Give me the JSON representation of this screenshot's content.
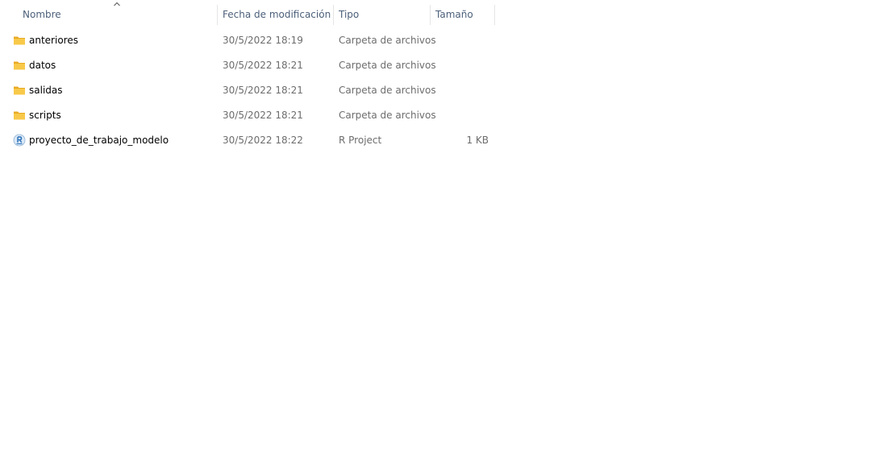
{
  "columns": {
    "name": "Nombre",
    "modified": "Fecha de modificación",
    "type": "Tipo",
    "size": "Tamaño"
  },
  "sort": {
    "column": "name",
    "icon": "chevron-up-icon"
  },
  "colors": {
    "folder": "#f8c94a",
    "folder_back": "#e8aa24",
    "rproject": "#2a6fb8"
  },
  "files": [
    {
      "name": "anteriores",
      "modified": "30/5/2022 18:19",
      "type": "Carpeta de archivos",
      "size": "",
      "icon": "folder-icon"
    },
    {
      "name": "datos",
      "modified": "30/5/2022 18:21",
      "type": "Carpeta de archivos",
      "size": "",
      "icon": "folder-icon"
    },
    {
      "name": "salidas",
      "modified": "30/5/2022 18:21",
      "type": "Carpeta de archivos",
      "size": "",
      "icon": "folder-icon"
    },
    {
      "name": "scripts",
      "modified": "30/5/2022 18:21",
      "type": "Carpeta de archivos",
      "size": "",
      "icon": "folder-icon"
    },
    {
      "name": "proyecto_de_trabajo_modelo",
      "modified": "30/5/2022 18:22",
      "type": "R Project",
      "size": "1 KB",
      "icon": "rproject-file-icon"
    }
  ]
}
